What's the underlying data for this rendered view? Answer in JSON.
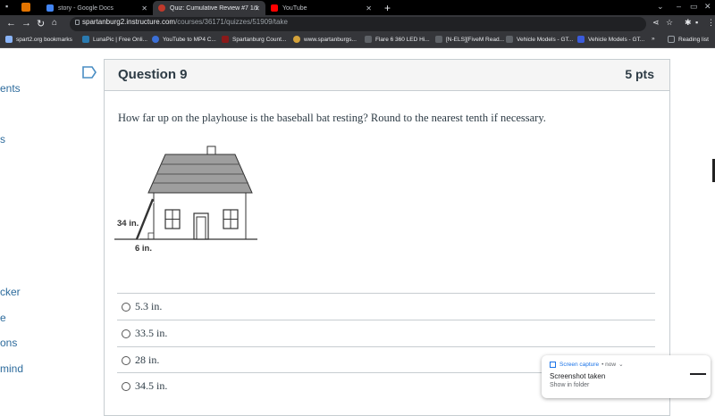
{
  "tabs": [
    {
      "label": "story - Google Docs",
      "active": false
    },
    {
      "label": "Quiz: Cumulative Review #7 1/1",
      "active": true
    },
    {
      "label": "YouTube",
      "active": false
    }
  ],
  "toolbar": {
    "url_host": "spartanburg2.instructure.com",
    "url_path": "/courses/36171/quizzes/51909/take"
  },
  "bookmarks": [
    "spart2.org bookmarks",
    "LunaPic | Free Onli...",
    "YouTube to MP4 C...",
    "Spartanburg Count...",
    "www.spartanburgs...",
    "Flare 6 360 LED Hi...",
    "[N-ELS][FiveM Read...",
    "Vehicle Models - GT...",
    "Vehicle Models - GT..."
  ],
  "reading_list": "Reading list",
  "sidebar_links": [
    "ents",
    "s",
    "cker",
    "e",
    "ons",
    "mind"
  ],
  "question": {
    "title": "Question 9",
    "points": "5 pts",
    "text": "How far up on the playhouse is the baseball bat resting? Round to the nearest tenth if necessary.",
    "figure": {
      "height_label": "34 in.",
      "base_label": "6 in."
    },
    "answers": [
      "5.3 in.",
      "33.5 in.",
      "28 in.",
      "34.5 in."
    ]
  },
  "toast": {
    "app": "Screen capture",
    "time": "• now",
    "title": "Screenshot taken",
    "subtitle": "Show in folder"
  },
  "colors": {
    "link": "#2d6b9c",
    "chrome_dark": "#202124",
    "chrome_mid": "#35363a",
    "text": "#2d3b45"
  }
}
